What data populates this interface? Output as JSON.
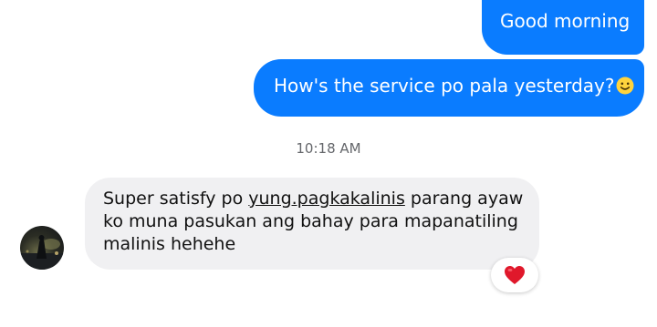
{
  "colors": {
    "outgoing_bubble": "#0a7cff",
    "incoming_bubble": "#f0f0f2",
    "timestamp_text": "#65676b",
    "reaction_heart": "#e0182b"
  },
  "messages_out": [
    {
      "text": "Good morning"
    },
    {
      "text": "How's the service po pala yesterday?",
      "emoji": "slightly-smiling-face-icon"
    }
  ],
  "timestamp": "10:18 AM",
  "message_in": {
    "part1": "Super satisfy po ",
    "link": "yung.pagkakalinis",
    "part2": " parang ayaw",
    "line2": "ko muna pasukan ang bahay para mapanatiling",
    "line3": "malinis hehehe",
    "reaction": "heart-icon"
  }
}
